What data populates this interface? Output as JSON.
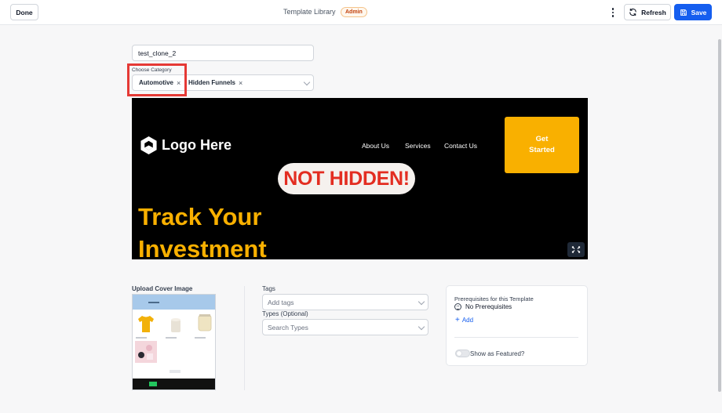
{
  "header": {
    "done_label": "Done",
    "title": "Template Library",
    "badge": "Admin",
    "refresh_label": "Refresh",
    "save_label": "Save",
    "accent": "#155eef"
  },
  "form": {
    "name_value": "test_clone_2",
    "category_label": "Choose Category",
    "categories": [
      {
        "label": "Automotive",
        "remove": "×"
      },
      {
        "label": "Hidden Funnels",
        "remove": "×"
      }
    ]
  },
  "preview": {
    "logo": "Logo Here",
    "nav": [
      "About Us",
      "Services",
      "Contact Us"
    ],
    "cta_line1": "Get",
    "cta_line2": "Started",
    "pill": "NOT HIDDEN!",
    "hero_line1": "Track Your",
    "hero_line2": "Investment",
    "colors": {
      "cta": "#f9b000",
      "pill_text": "#e32d21",
      "hero": "#f9b000"
    }
  },
  "cover": {
    "label": "Upload Cover Image"
  },
  "tags": {
    "label": "Tags",
    "placeholder": "Add tags"
  },
  "types": {
    "label": "Types (Optional)",
    "placeholder": "Search Types"
  },
  "prerequisites": {
    "title": "Prerequisites for this Template",
    "none_text": "No Prerequisites",
    "add_label": "Add",
    "featured_label": "Show as Featured?"
  }
}
